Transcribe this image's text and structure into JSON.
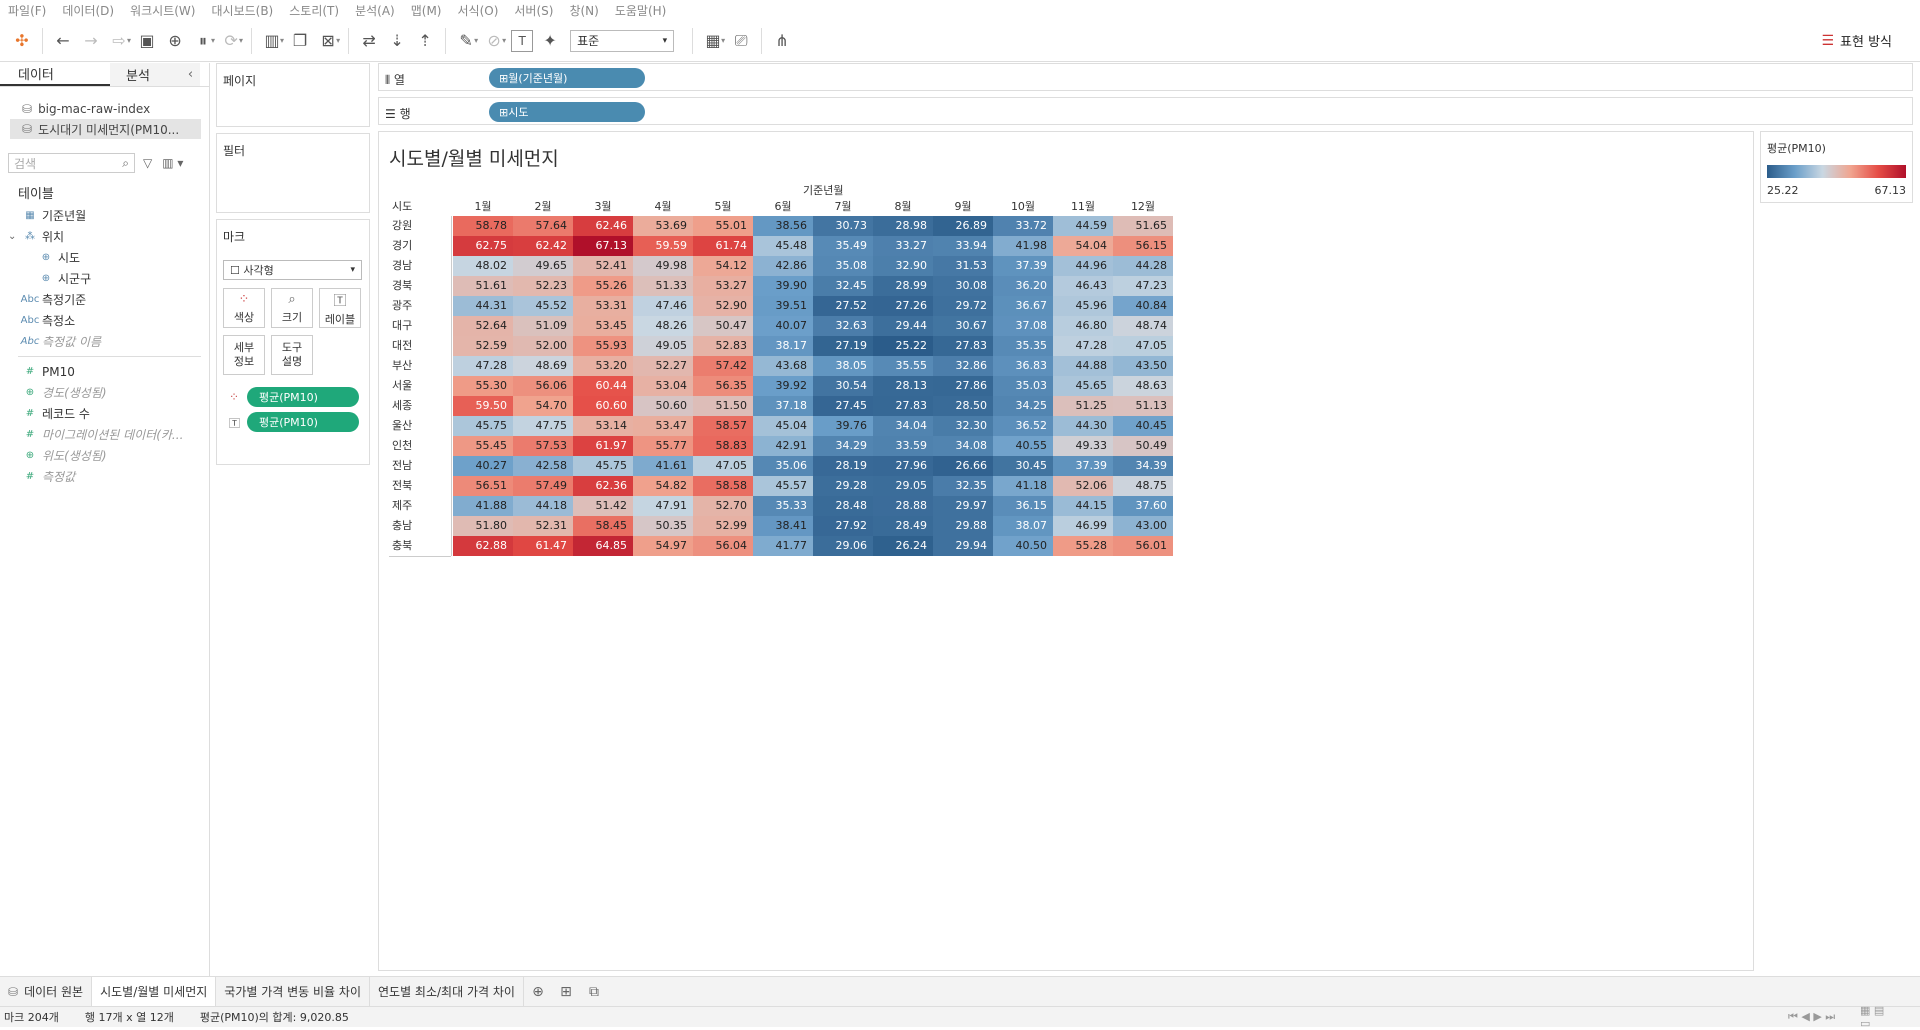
{
  "menu": [
    "파일(F)",
    "데이터(D)",
    "워크시트(W)",
    "대시보드(B)",
    "스토리(T)",
    "분석(A)",
    "맵(M)",
    "서식(O)",
    "서버(S)",
    "창(N)",
    "도움말(H)"
  ],
  "toolbar": {
    "format_select": "표준",
    "show_me": "표현 방식"
  },
  "left": {
    "tab_data": "데이터",
    "tab_analysis": "분석",
    "datasources": [
      "big-mac-raw-index",
      "도시대기 미세먼지(PM10..."
    ],
    "search_placeholder": "검색",
    "tables_header": "테이블",
    "fields": [
      {
        "name": "기준년월",
        "icon": "calendar-icon",
        "style": "normal"
      },
      {
        "name": "위치",
        "icon": "hierarchy-icon",
        "style": "normal"
      },
      {
        "name": "시도",
        "icon": "globe-icon",
        "style": "sub"
      },
      {
        "name": "시군구",
        "icon": "globe-icon",
        "style": "sub"
      },
      {
        "name": "측정기준",
        "icon": "abc-icon",
        "style": "normal"
      },
      {
        "name": "측정소",
        "icon": "abc-icon",
        "style": "normal"
      },
      {
        "name": "측정값 이름",
        "icon": "abc-icon",
        "style": "italic"
      },
      {
        "name": "PM10",
        "icon": "hash-icon",
        "style": "measure"
      },
      {
        "name": "경도(생성됨)",
        "icon": "globe-icon",
        "style": "italic-green"
      },
      {
        "name": "레코드 수",
        "icon": "hash-icon",
        "style": "measure"
      },
      {
        "name": "마이그레이션된 데이터(카...",
        "icon": "hash-icon",
        "style": "italic-green"
      },
      {
        "name": "위도(생성됨)",
        "icon": "globe-icon",
        "style": "italic-green"
      },
      {
        "name": "측정값",
        "icon": "hash-icon",
        "style": "italic-green"
      }
    ]
  },
  "shelves": {
    "pages": "페이지",
    "filters": "필터",
    "marks": "마크",
    "mark_type": "사각형",
    "color": "색상",
    "size": "크기",
    "label": "레이블",
    "detail": "세부 정보",
    "tooltip": "도구 설명",
    "pill_color": "평균(PM10)",
    "pill_label": "평균(PM10)",
    "columns_label": "열",
    "rows_label": "행",
    "columns_pill": "월(기준년월)",
    "rows_pill": "시도"
  },
  "legend": {
    "title": "평균(PM10)",
    "min": "25.22",
    "max": "67.13"
  },
  "chart_data": {
    "type": "heatmap",
    "title": "시도별/월별 미세먼지",
    "column_header": "기준년월",
    "row_header": "시도",
    "categories": [
      "1월",
      "2월",
      "3월",
      "4월",
      "5월",
      "6월",
      "7월",
      "8월",
      "9월",
      "10월",
      "11월",
      "12월"
    ],
    "rows": [
      "강원",
      "경기",
      "경남",
      "경북",
      "광주",
      "대구",
      "대전",
      "부산",
      "서울",
      "세종",
      "울산",
      "인천",
      "전남",
      "전북",
      "제주",
      "충남",
      "충북"
    ],
    "values": [
      [
        58.78,
        57.64,
        62.46,
        53.69,
        55.01,
        38.56,
        30.73,
        28.98,
        26.89,
        33.72,
        44.59,
        51.65
      ],
      [
        62.75,
        62.42,
        67.13,
        59.59,
        61.74,
        45.48,
        35.49,
        33.27,
        33.94,
        41.98,
        54.04,
        56.15
      ],
      [
        48.02,
        49.65,
        52.41,
        49.98,
        54.12,
        42.86,
        35.08,
        32.9,
        31.53,
        37.39,
        44.96,
        44.28
      ],
      [
        51.61,
        52.23,
        55.26,
        51.33,
        53.27,
        39.9,
        32.45,
        28.99,
        30.08,
        36.2,
        46.43,
        47.23
      ],
      [
        44.31,
        45.52,
        53.31,
        47.46,
        52.9,
        39.51,
        27.52,
        27.26,
        29.72,
        36.67,
        45.96,
        40.84
      ],
      [
        52.64,
        51.09,
        53.45,
        48.26,
        50.47,
        40.07,
        32.63,
        29.44,
        30.67,
        37.08,
        46.8,
        48.74
      ],
      [
        52.59,
        52.0,
        55.93,
        49.05,
        52.83,
        38.17,
        27.19,
        25.22,
        27.83,
        35.35,
        47.28,
        47.05
      ],
      [
        47.28,
        48.69,
        53.2,
        52.27,
        57.42,
        43.68,
        38.05,
        35.55,
        32.86,
        36.83,
        44.88,
        43.5
      ],
      [
        55.3,
        56.06,
        60.44,
        53.04,
        56.35,
        39.92,
        30.54,
        28.13,
        27.86,
        35.03,
        45.65,
        48.63
      ],
      [
        59.5,
        54.7,
        60.6,
        50.6,
        51.5,
        37.18,
        27.45,
        27.83,
        28.5,
        34.25,
        51.25,
        51.13
      ],
      [
        45.75,
        47.75,
        53.14,
        53.47,
        58.57,
        45.04,
        39.76,
        34.04,
        32.3,
        36.52,
        44.3,
        40.45
      ],
      [
        55.45,
        57.53,
        61.97,
        55.77,
        58.83,
        42.91,
        34.29,
        33.59,
        34.08,
        40.55,
        49.33,
        50.49
      ],
      [
        40.27,
        42.58,
        45.75,
        41.61,
        47.05,
        35.06,
        28.19,
        27.96,
        26.66,
        30.45,
        37.39,
        34.39
      ],
      [
        56.51,
        57.49,
        62.36,
        54.82,
        58.58,
        45.57,
        29.28,
        29.05,
        32.35,
        41.18,
        52.06,
        48.75
      ],
      [
        41.88,
        44.18,
        51.42,
        47.91,
        52.7,
        35.33,
        28.48,
        28.88,
        29.97,
        36.15,
        44.15,
        37.6
      ],
      [
        51.8,
        52.31,
        58.45,
        50.35,
        52.99,
        38.41,
        27.92,
        28.49,
        29.88,
        38.07,
        46.99,
        43.0
      ],
      [
        62.88,
        61.47,
        64.85,
        54.97,
        56.04,
        41.77,
        29.06,
        26.24,
        29.94,
        40.5,
        55.28,
        56.01
      ]
    ],
    "color_min": 25.22,
    "color_max": 67.13
  },
  "bottom_tabs": [
    "데이터 원본",
    "시도별/월별 미세먼지",
    "국가별 가격 변동 비율 차이",
    "연도별 최소/최대 가격 차이"
  ],
  "status": {
    "marks": "마크 204개",
    "dims": "행 17개 x 열 12개",
    "sum": "평균(PM10)의 합계: 9,020.85"
  }
}
